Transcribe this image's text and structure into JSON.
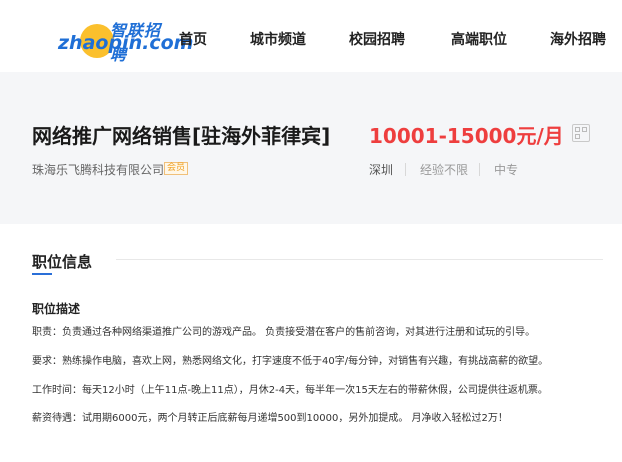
{
  "header": {
    "logo_cn": "智联招聘",
    "logo_en": "zhaopin.com",
    "nav": [
      "首页",
      "城市频道",
      "校园招聘",
      "高端职位",
      "海外招聘"
    ]
  },
  "job": {
    "title": "网络推广网络销售[驻海外菲律宾]",
    "salary": "10001-15000元/月",
    "company": "珠海乐飞腾科技有限公司",
    "member_badge": "会员",
    "city": "深圳",
    "experience": "经验不限",
    "education": "中专"
  },
  "info": {
    "section_title": "职位信息",
    "description_heading": "职位描述",
    "lines": [
      "职责：负责通过各种网络渠道推广公司的游戏产品。 负责接受潜在客户的售前咨询，对其进行注册和试玩的引导。",
      "要求：熟练操作电脑，喜欢上网，熟悉网络文化，打字速度不低于40字/每分钟，对销售有兴趣，有挑战高薪的欲望。",
      "工作时间：每天12小时（上午11点-晚上11点），月休2-4天，每半年一次15天左右的带薪休假，公司提供往返机票。",
      "薪资待遇：试用期6000元，两个月转正后底薪每月递增500到10000，另外加提成。 月净收入轻松过2万！"
    ]
  },
  "colors": {
    "salary": "#ee3e3e",
    "accent": "#2a6fd8",
    "hero_bg": "#f5f6f8"
  }
}
